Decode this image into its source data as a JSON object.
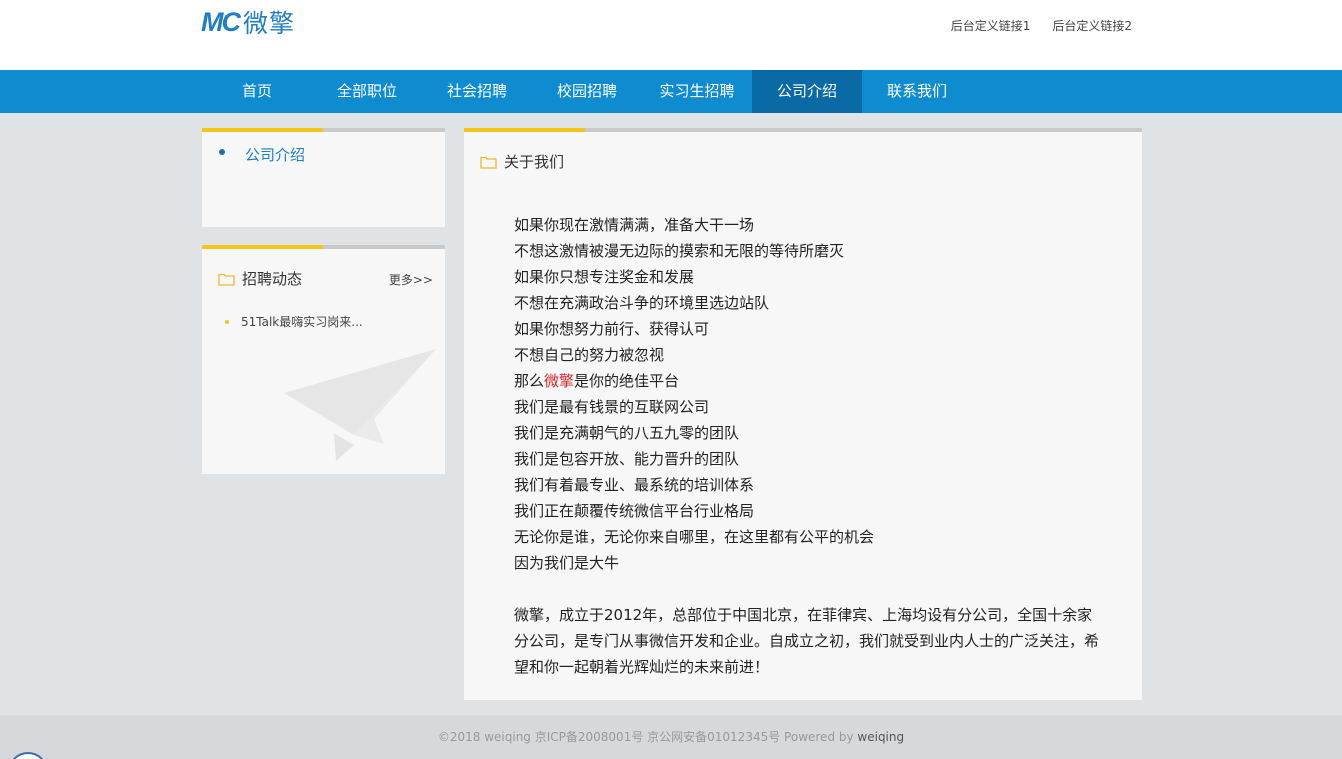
{
  "header": {
    "logo_mark": "MC",
    "logo_text": "微擎",
    "top_links": [
      "后台定义链接1",
      "后台定义链接2"
    ]
  },
  "nav": {
    "items": [
      "首页",
      "全部职位",
      "社会招聘",
      "校园招聘",
      "实习生招聘",
      "公司介绍",
      "联系我们"
    ],
    "active": "公司介绍"
  },
  "sidebar": {
    "menu_item": "公司介绍",
    "news": {
      "title": "招聘动态",
      "more": "更多>>",
      "items": [
        "51Talk最嗨实习岗来..."
      ]
    }
  },
  "main": {
    "title": "关于我们",
    "lines": [
      "如果你现在激情满满，准备大干一场",
      "不想这激情被漫无边际的摸索和无限的等待所磨灭",
      "如果你只想专注奖金和发展",
      "不想在充满政治斗争的环境里选边站队",
      "如果你想努力前行、获得认可",
      "不想自己的努力被忽视"
    ],
    "highlight_line": {
      "before": "那么",
      "brand": "微擎",
      "after": "是你的绝佳平台"
    },
    "lines2": [
      "我们是最有钱景的互联网公司",
      "我们是充满朝气的八五九零的团队",
      "我们是包容开放、能力晋升的团队",
      "我们有着最专业、最系统的培训体系",
      "我们正在颠覆传统微信平台行业格局",
      "无论你是谁，无论你来自哪里，在这里都有公平的机会",
      "因为我们是大牛"
    ],
    "paragraph": "微擎，成立于2012年，总部位于中国北京，在菲律宾、上海均设有分公司，全国十余家分公司，是专门从事微信开发和企业。自成立之初，我们就受到业内人士的广泛关注，希望和你一起朝着光辉灿烂的未来前进！"
  },
  "footer": {
    "copyright": "©2018  weiqing  京ICP备2008001号 京公网安备01012345号  Powered by ",
    "powered": "weiqing"
  },
  "colors": {
    "nav_bg": "#0e8ccf",
    "nav_active": "#0a6aa6",
    "accent_yellow": "#f5c518",
    "brand_red": "#d42a2a"
  }
}
